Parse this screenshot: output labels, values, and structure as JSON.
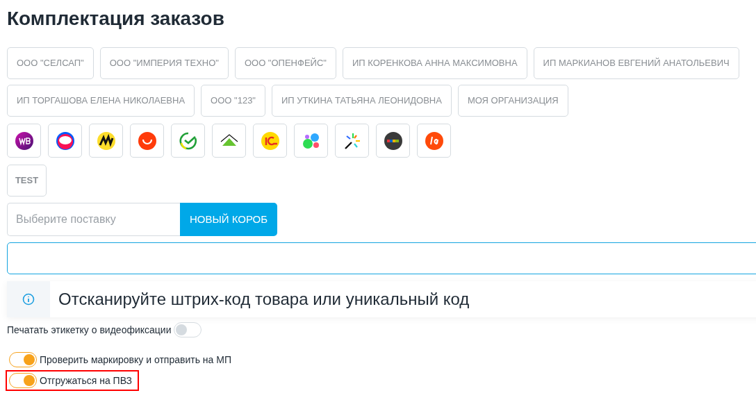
{
  "title": "Комплектация заказов",
  "organizations": [
    {
      "label": "ООО \"СЕЛСАП\""
    },
    {
      "label": "ООО \"ИМПЕРИЯ ТЕХНО\""
    },
    {
      "label": "ООО \"ОПЕНФЕЙС\""
    },
    {
      "label": "ИП КОРЕНКОВА АННА МАКСИМОВНА"
    },
    {
      "label": "ИП МАРКИАНОВ ЕВГЕНИЙ АНАТОЛЬЕВИЧ"
    },
    {
      "label": "ИП ТОРГАШОВА ЕЛЕНА НИКОЛАЕВНА"
    },
    {
      "label": "ООО \"123\""
    },
    {
      "label": "ИП УТКИНА ТАТЬЯНА ЛЕОНИДОВНА"
    },
    {
      "label": "МОЯ ОРГАНИЗАЦИЯ"
    }
  ],
  "marketplaces": [
    {
      "kind": "wb"
    },
    {
      "kind": "ozon"
    },
    {
      "kind": "ym"
    },
    {
      "kind": "ali"
    },
    {
      "kind": "sber"
    },
    {
      "kind": "leroy"
    },
    {
      "kind": "onec"
    },
    {
      "kind": "blobs"
    },
    {
      "kind": "burst"
    },
    {
      "kind": "ebay"
    },
    {
      "kind": "la"
    }
  ],
  "extra_buttons": [
    {
      "label": "TEST"
    }
  ],
  "supply": {
    "placeholder": "Выберите поставку",
    "button": "НОВЫЙ КОРОБ"
  },
  "scan_hint": "Отсканируйте штрих-код товара или уникальный код",
  "video_toggle": {
    "label": "Печатать этикетку о видеофиксации",
    "on": false
  },
  "toggles": [
    {
      "label": "Проверить маркировку и отправить на МП",
      "on": true,
      "highlighted": false
    },
    {
      "label": "Отгружаться на ПВЗ",
      "on": true,
      "highlighted": true
    }
  ]
}
